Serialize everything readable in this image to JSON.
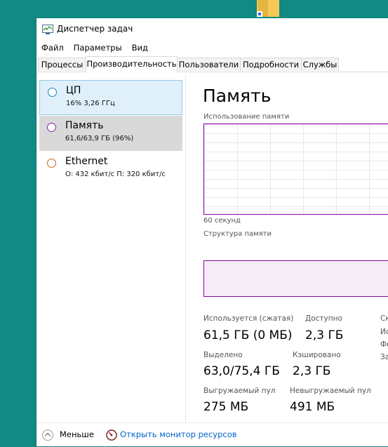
{
  "window": {
    "title": "Диспетчер задач"
  },
  "menu": [
    "Файл",
    "Параметры",
    "Вид"
  ],
  "tabs": [
    "Процессы",
    "Производительность",
    "Пользователи",
    "Подробности",
    "Службы"
  ],
  "active_tab": "Производительность",
  "sidebar": {
    "items": [
      {
        "name": "ЦП",
        "detail": "16%  3,26 ГГц",
        "ring_color": "#1b84c9",
        "state": "selected"
      },
      {
        "name": "Память",
        "detail": "61,6/63,9 ГБ (96%)",
        "ring_color": "#8b1ca6",
        "state": "hover"
      },
      {
        "name": "Ethernet",
        "detail": "О: 432 кбит/с  П: 320 кбит/с",
        "ring_color": "#c5671e",
        "state": "normal"
      }
    ]
  },
  "memory": {
    "heading": "Память",
    "usage_caption": "Использование памяти",
    "time_caption": "60 секунд",
    "structure_caption": "Структура памяти",
    "accent": "#8a00a0",
    "stats": {
      "in_use_label": "Используется (сжатая)",
      "in_use_value": "61,5 ГБ (0 МБ)",
      "available_label": "Доступно",
      "available_value": "2,3 ГБ",
      "committed_label": "Выделено",
      "committed_value": "63,0/75,4 ГБ",
      "cached_label": "Кэшировано",
      "cached_value": "2,3 ГБ",
      "paged_label": "Выгружаемый пул",
      "paged_value": "275 МБ",
      "nonpaged_label": "Невыгружаемый пул",
      "nonpaged_value": "491 МБ"
    },
    "clipped_letters": [
      "Ск",
      "Ис",
      "Фо",
      "За"
    ]
  },
  "footer": {
    "fewer_label": "Меньше",
    "resmon_label": "Открыть монитор ресурсов"
  }
}
